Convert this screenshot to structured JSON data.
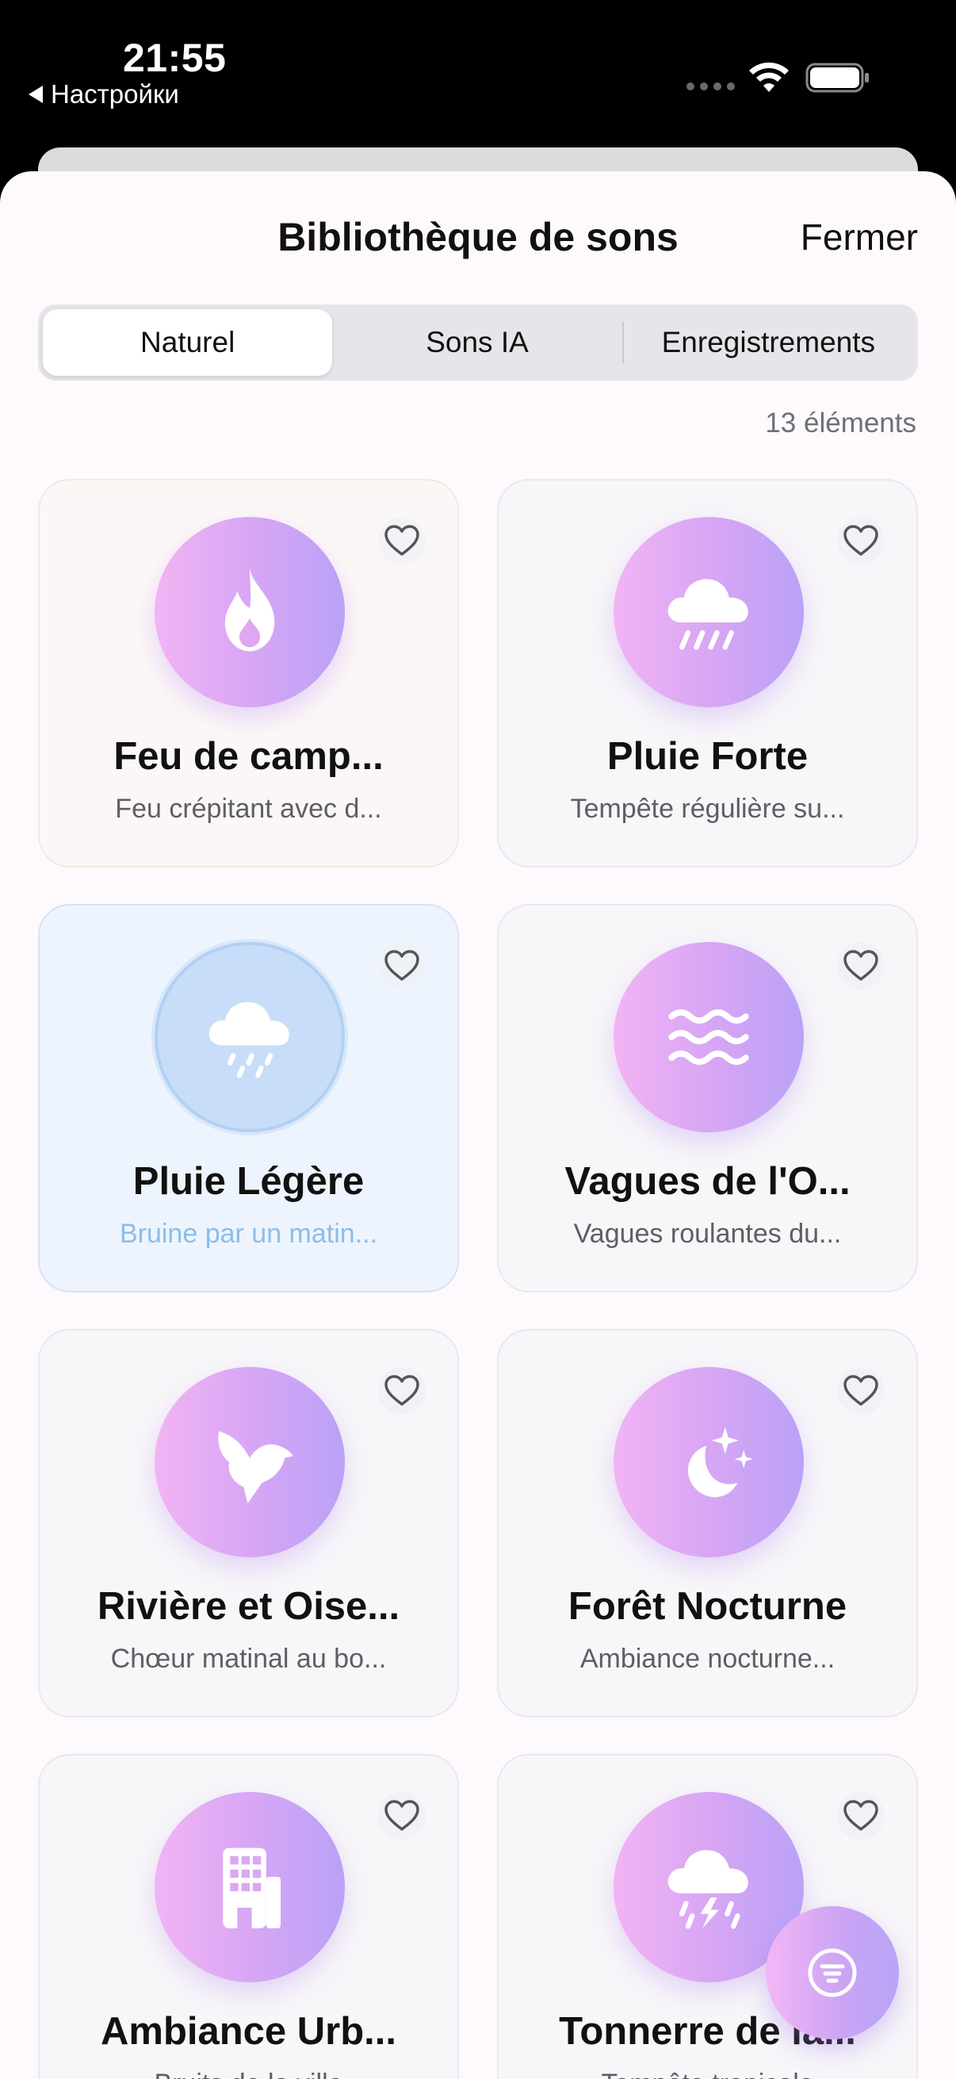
{
  "status_bar": {
    "time": "21:55",
    "back_app": "Настройки"
  },
  "header": {
    "title": "Bibliothèque de sons",
    "close_label": "Fermer"
  },
  "tabs": [
    {
      "label": "Naturel",
      "active": true
    },
    {
      "label": "Sons IA",
      "active": false
    },
    {
      "label": "Enregistrements",
      "active": false
    }
  ],
  "count_label": "13 éléments",
  "sounds": [
    {
      "name": "Feu de camp...",
      "desc": "Feu crépitant avec d...",
      "icon": "flame-icon"
    },
    {
      "name": "Pluie Forte",
      "desc": "Tempête régulière su...",
      "icon": "heavy-rain-icon"
    },
    {
      "name": "Pluie Légère",
      "desc": "Bruine par un matin...",
      "icon": "light-rain-icon",
      "selected": true
    },
    {
      "name": "Vagues de l'O...",
      "desc": "Vagues roulantes du...",
      "icon": "waves-icon"
    },
    {
      "name": "Rivière et Oise...",
      "desc": "Chœur matinal au bo...",
      "icon": "bird-icon"
    },
    {
      "name": "Forêt Nocturne",
      "desc": "Ambiance nocturne...",
      "icon": "moon-stars-icon"
    },
    {
      "name": "Ambiance Urb...",
      "desc": "Bruits de la ville",
      "icon": "building-icon"
    },
    {
      "name": "Tonnerre de la...",
      "desc": "Tempête tropicale",
      "icon": "thunderstorm-icon"
    }
  ],
  "colors": {
    "accent_gradient_start": "#f2b4f4",
    "accent_gradient_end": "#b9a2f7",
    "selected_blue": "#c8ddf7"
  }
}
